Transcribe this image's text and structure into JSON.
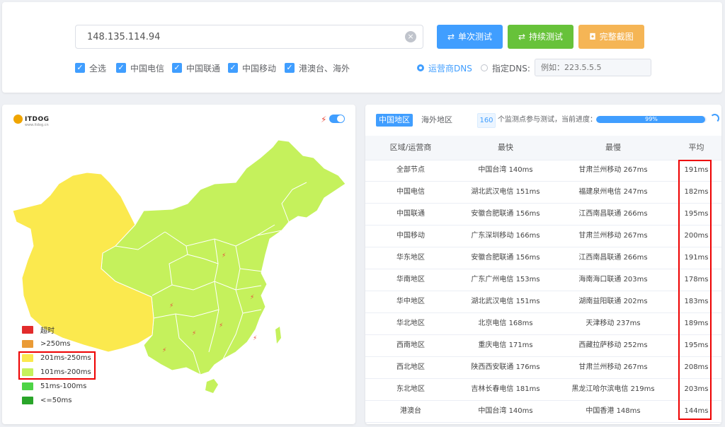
{
  "top": {
    "ip_value": "148.135.114.94",
    "clear_icon": "×",
    "buttons": {
      "single": "单次测试",
      "continuous": "持续测试",
      "screenshot": "完整截图"
    },
    "checkboxes": [
      "全选",
      "中国电信",
      "中国联通",
      "中国移动",
      "港澳台、海外"
    ],
    "dns": {
      "isp_dns": "运营商DNS",
      "custom_dns": "指定DNS:",
      "custom_placeholder": "例如：223.5.5.5",
      "selected": "isp"
    }
  },
  "map": {
    "logo_text": "ITDOG",
    "logo_sub": "www.itdog.cn",
    "legend": [
      {
        "label": "超时",
        "color": "#e22b2b"
      },
      {
        "label": ">250ms",
        "color": "#ea9b36"
      },
      {
        "label": "201ms-250ms",
        "color": "#fbe94e"
      },
      {
        "label": "101ms-200ms",
        "color": "#c5f15c"
      },
      {
        "label": "51ms-100ms",
        "color": "#4ed446"
      },
      {
        "label": "<=50ms",
        "color": "#2aa52a"
      }
    ],
    "colors": {
      "west": "#fbe94e",
      "main": "#c5f15c",
      "bolt": "#e84c3d"
    }
  },
  "table": {
    "tabs": [
      "中国地区",
      "海外地区"
    ],
    "monitor_count": "160",
    "progress_text": "个监测点参与测试，当前进度：",
    "progress_percent": "99%",
    "progress_value": 0.99,
    "headers": [
      "区域/运营商",
      "最快",
      "最慢",
      "平均"
    ],
    "rows": [
      [
        "全部节点",
        "中国台湾 140ms",
        "甘肃兰州移动 267ms",
        "191ms"
      ],
      [
        "中国电信",
        "湖北武汉电信 151ms",
        "福建泉州电信 247ms",
        "182ms"
      ],
      [
        "中国联通",
        "安徽合肥联通 156ms",
        "江西南昌联通 266ms",
        "195ms"
      ],
      [
        "中国移动",
        "广东深圳移动 166ms",
        "甘肃兰州移动 267ms",
        "200ms"
      ],
      [
        "华东地区",
        "安徽合肥联通 156ms",
        "江西南昌联通 266ms",
        "191ms"
      ],
      [
        "华南地区",
        "广东广州电信 153ms",
        "海南海口联通 203ms",
        "178ms"
      ],
      [
        "华中地区",
        "湖北武汉电信 151ms",
        "湖南益阳联通 202ms",
        "183ms"
      ],
      [
        "华北地区",
        "北京电信 168ms",
        "天津移动 237ms",
        "189ms"
      ],
      [
        "西南地区",
        "重庆电信 171ms",
        "西藏拉萨移动 252ms",
        "195ms"
      ],
      [
        "西北地区",
        "陕西西安联通 176ms",
        "甘肃兰州移动 267ms",
        "208ms"
      ],
      [
        "东北地区",
        "吉林长春电信 181ms",
        "黑龙江哈尔滨电信 219ms",
        "203ms"
      ],
      [
        "港澳台",
        "中国台湾 140ms",
        "中国香港 148ms",
        "144ms"
      ]
    ]
  }
}
